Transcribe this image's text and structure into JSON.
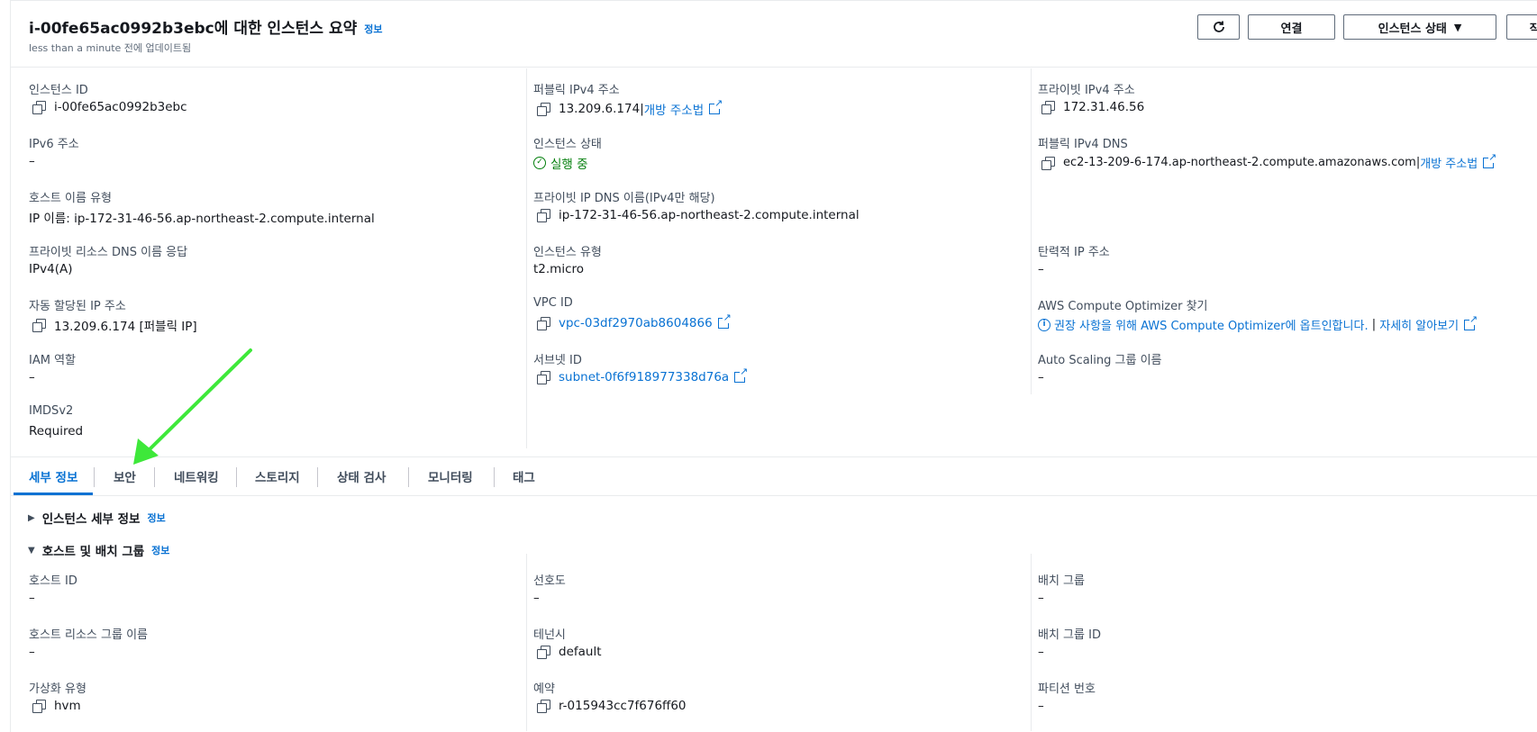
{
  "header": {
    "title": "i-00fe65ac0992b3ebc에 대한 인스턴스 요약",
    "info": "정보",
    "subtitle": "less than a minute 전에 업데이트됨",
    "buttons": {
      "connect": "연결",
      "instance_state": "인스턴스 상태",
      "actions": "작업"
    }
  },
  "summary": {
    "col1": {
      "instance_id_label": "인스턴스 ID",
      "instance_id": "i-00fe65ac0992b3ebc",
      "ipv6_label": "IPv6 주소",
      "ipv6": "–",
      "hostname_type_label": "호스트 이름 유형",
      "hostname_type": "IP 이름: ip-172-31-46-56.ap-northeast-2.compute.internal",
      "private_dns_answer_label": "프라이빗 리소스 DNS 이름 응답",
      "private_dns_answer": "IPv4(A)",
      "auto_ip_label": "자동 할당된 IP 주소",
      "auto_ip": "13.209.6.174 [퍼블릭 IP]",
      "iam_role_label": "IAM 역할",
      "iam_role": "–",
      "imdsv2_label": "IMDSv2",
      "imdsv2": "Required"
    },
    "col2": {
      "public_ipv4_label": "퍼블릭 IPv4 주소",
      "public_ipv4": "13.209.6.174",
      "public_ipv4_sep": " |",
      "open_address": "개방 주소법",
      "state_label": "인스턴스 상태",
      "state": "실행 중",
      "private_ip_dns_label": "프라이빗 IP DNS 이름(IPv4만 해당)",
      "private_ip_dns": "ip-172-31-46-56.ap-northeast-2.compute.internal",
      "instance_type_label": "인스턴스 유형",
      "instance_type": "t2.micro",
      "vpc_label": "VPC ID",
      "vpc": "vpc-03df2970ab8604866",
      "subnet_label": "서브넷 ID",
      "subnet": "subnet-0f6f918977338d76a"
    },
    "col3": {
      "private_ipv4_label": "프라이빗 IPv4 주소",
      "private_ipv4": "172.31.46.56",
      "public_dns_label": "퍼블릭 IPv4 DNS",
      "public_dns": "ec2-13-209-6-174.ap-northeast-2.compute.amazonaws.com",
      "public_dns_sep": " |",
      "open_address": "개방 주소법",
      "elastic_ip_label": "탄력적 IP 주소",
      "elastic_ip": "–",
      "optimizer_label": "AWS Compute Optimizer 찾기",
      "optimizer_text": "권장 사항을 위해 AWS Compute Optimizer에 옵트인합니다.",
      "optimizer_sep": " | ",
      "learn_more": "자세히 알아보기",
      "asg_label": "Auto Scaling 그룹 이름",
      "asg": "–"
    }
  },
  "tabs": [
    "세부 정보",
    "보안",
    "네트워킹",
    "스토리지",
    "상태 검사",
    "모니터링",
    "태그"
  ],
  "details": {
    "instance_details": "인스턴스 세부 정보",
    "host_placement": "호스트 및 배치 그룹",
    "info": "정보",
    "host_id_label": "호스트 ID",
    "host_id": "–",
    "host_rg_label": "호스트 리소스 그룹 이름",
    "host_rg": "–",
    "virt_label": "가상화 유형",
    "virt": "hvm",
    "affinity_label": "선호도",
    "affinity": "–",
    "tenancy_label": "테넌시",
    "tenancy": "default",
    "reservation_label": "예약",
    "reservation": "r-015943cc7f676ff60",
    "placement_label": "배치 그룹",
    "placement": "–",
    "placement_id_label": "배치 그룹 ID",
    "placement_id": "–",
    "partition_label": "파티션 번호",
    "partition": "–"
  },
  "colors": {
    "link": "#0972d3",
    "success": "#037f0c",
    "annotation_arrow": "#3ee83a"
  },
  "icons": [
    "refresh-icon",
    "copy-icon",
    "external-link-icon",
    "check-circle-icon",
    "info-icon",
    "caret-down-icon",
    "caret-right-icon"
  ]
}
